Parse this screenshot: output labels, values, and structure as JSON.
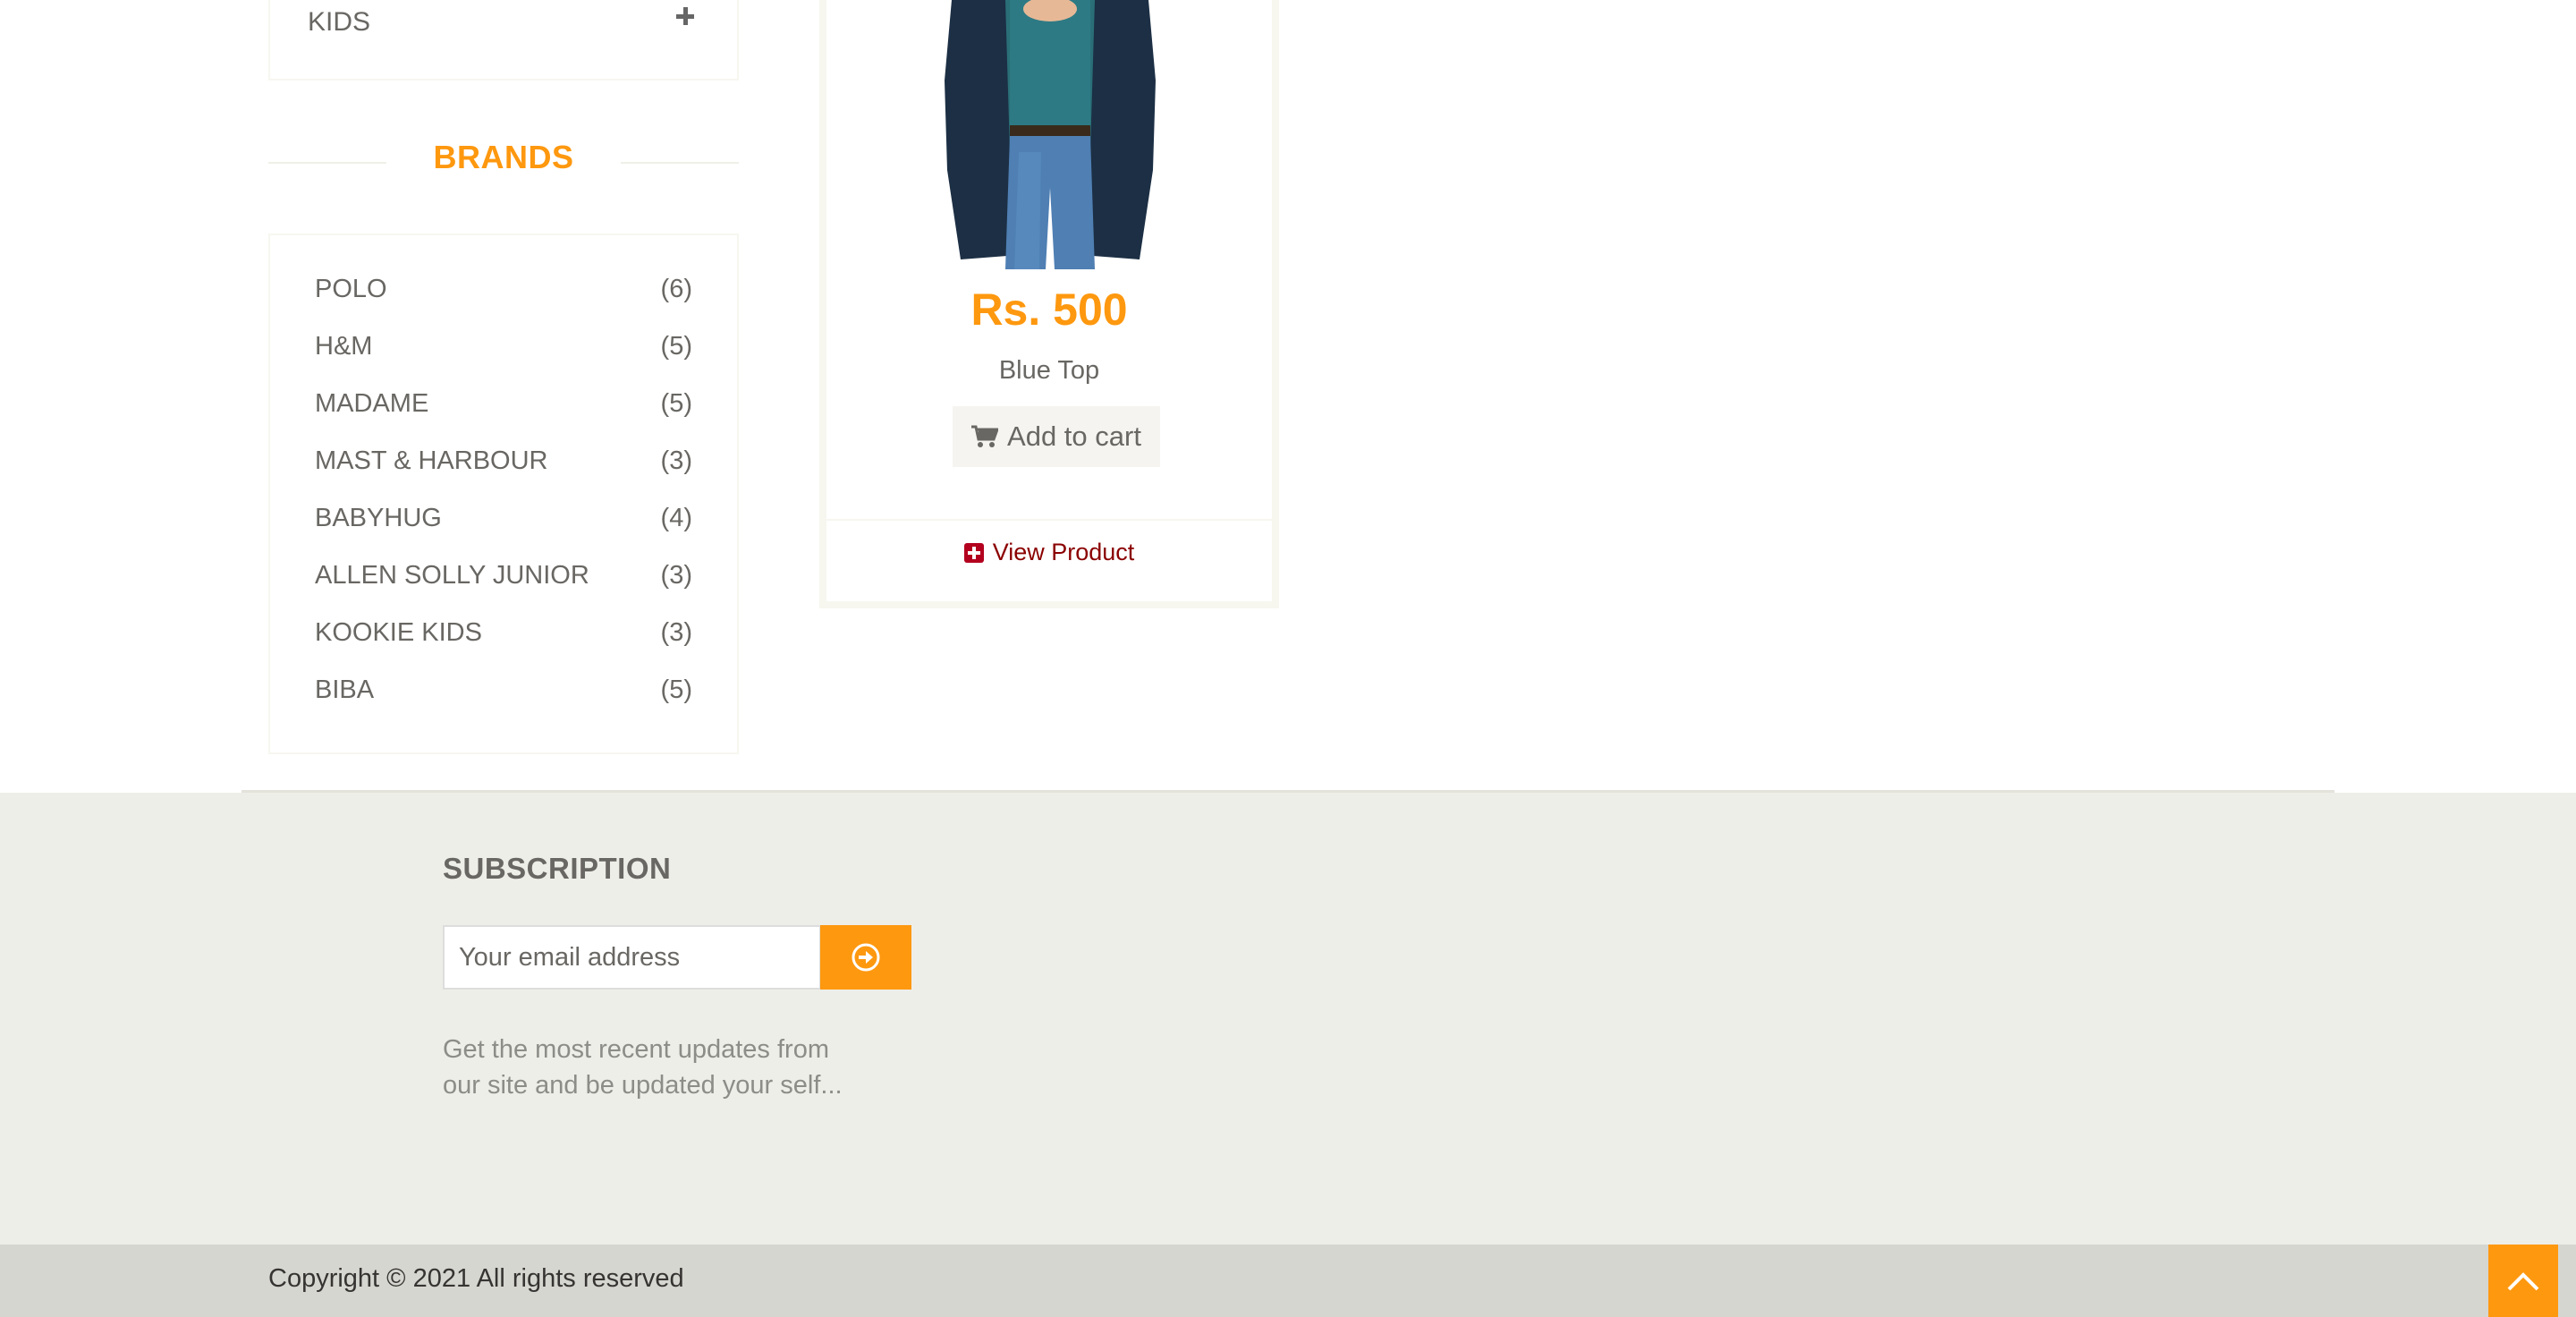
{
  "sidebar": {
    "category": {
      "label": "KIDS"
    },
    "brands_heading": "BRANDS",
    "brands": [
      {
        "name": "POLO",
        "count": "(6)"
      },
      {
        "name": "H&M",
        "count": "(5)"
      },
      {
        "name": "MADAME",
        "count": "(5)"
      },
      {
        "name": "MAST & HARBOUR",
        "count": "(3)"
      },
      {
        "name": "BABYHUG",
        "count": "(4)"
      },
      {
        "name": "ALLEN SOLLY JUNIOR",
        "count": "(3)"
      },
      {
        "name": "KOOKIE KIDS",
        "count": "(3)"
      },
      {
        "name": "BIBA",
        "count": "(5)"
      }
    ]
  },
  "product": {
    "price": "Rs. 500",
    "name": "Blue Top",
    "add_to_cart_label": "Add to cart",
    "view_product_label": "View Product"
  },
  "footer": {
    "subscription_title": "SUBSCRIPTION",
    "email_placeholder": "Your email address",
    "description": "Get the most recent updates from our site and be updated your self...",
    "copyright": "Copyright © 2021 All rights reserved"
  },
  "colors": {
    "accent": "#fe980f",
    "view_product": "#8b0000",
    "footer_bg": "#eeeee8",
    "footer_bottom_bg": "#d6d6d0"
  },
  "icons": {
    "expand": "plus-icon",
    "cart": "shopping-cart-icon",
    "view": "plus-square-icon",
    "subscribe": "arrow-circle-right-icon",
    "scroll_up": "chevron-up-icon"
  }
}
